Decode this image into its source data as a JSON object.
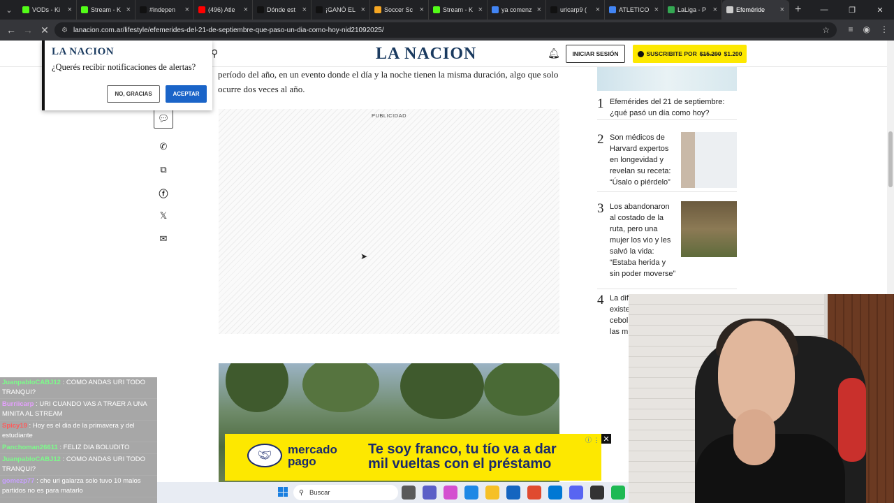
{
  "browser": {
    "tabs": [
      {
        "title": "VODs - Ki",
        "color": "#53fc18"
      },
      {
        "title": "Stream - K",
        "color": "#53fc18"
      },
      {
        "title": "#indepen",
        "color": "#111111"
      },
      {
        "title": "(496) Atle",
        "color": "#ff0000"
      },
      {
        "title": "Dónde est",
        "color": "#111111"
      },
      {
        "title": "¡GANÓ EL",
        "color": "#111111"
      },
      {
        "title": "Soccer Sc",
        "color": "#f5a623"
      },
      {
        "title": "Stream - K",
        "color": "#53fc18"
      },
      {
        "title": "ya comenz",
        "color": "#4285f4"
      },
      {
        "title": "uricarp9 (",
        "color": "#111111"
      },
      {
        "title": "ATLETICO",
        "color": "#4285f4"
      },
      {
        "title": "LaLiga - P",
        "color": "#34a853"
      },
      {
        "title": "Efeméride",
        "color": "#cccccc"
      }
    ],
    "url": "lanacion.com.ar/lifestyle/efemerides-del-21-de-septiembre-que-paso-un-dia-como-hoy-nid21092025/"
  },
  "header": {
    "logo": "LA NACION",
    "login_label": "INICIAR SESIÓN",
    "subscribe_prefix": "SUSCRIBITE POR",
    "subscribe_old_price": "$15.290",
    "subscribe_new_price": "$1.200"
  },
  "article": {
    "text": "período del año, en un evento donde el día y la noche tienen la misma duración, algo que solo ocurre dos veces al año.",
    "ad_label": "PUBLICIDAD"
  },
  "notification": {
    "logo": "LA NACION",
    "question": "¿Querés recibir notificaciones de alertas?",
    "decline_label": "NO, GRACIAS",
    "accept_label": "ACEPTAR"
  },
  "ranking": [
    {
      "num": "1",
      "title": "Efemérides del 21 de septiembre: ¿qué pasó un día como hoy?"
    },
    {
      "num": "2",
      "title": "Son médicos de Harvard expertos en longevidad y revelan su receta: “Úsalo o piérdelo”"
    },
    {
      "num": "3",
      "title": "Los abandonaron al costado de la ruta, pero una mujer los vio y les salvó la vida: “Estaba herida y sin poder moverse”"
    },
    {
      "num": "4",
      "title": "La dif existe cebol las m"
    }
  ],
  "ad_banner": {
    "brand_line1": "mercado",
    "brand_line2": "pago",
    "slogan_line1": "Te soy franco, tu tío va a dar",
    "slogan_line2": "mil vueltas con el préstamo"
  },
  "chat": [
    {
      "user": "JuanpabloCABJ12",
      "color": "#7cfc8a",
      "text": "COMO ANDAS URI TODO TRANQUI?"
    },
    {
      "user": "Burriicarp",
      "color": "#e6a0ff",
      "text": "URI CUANDO VAS A TRAER A UNA MINITA AL STREAM"
    },
    {
      "user": "Spicy19",
      "color": "#ff5a5a",
      "text": "Hoy es el dia de la primavera y del estudiante"
    },
    {
      "user": "Panchoman26611",
      "color": "#7cfc8a",
      "text": "FELIZ DIA BOLUDITO"
    },
    {
      "user": "JuanpabloCABJ12",
      "color": "#7cfc8a",
      "text": "COMO ANDAS URI TODO TRANQUI?"
    },
    {
      "user": "gomezp77",
      "color": "#c8a0ff",
      "text": "che uri galarza solo tuvo 10 malos partidos no es para matarlo"
    }
  ],
  "taskbar": {
    "search_placeholder": "Buscar",
    "icon_colors": [
      "#5a5a5a",
      "#5b5fc7",
      "#d44fd0",
      "#1e88e5",
      "#f6c026",
      "#1565c0",
      "#e04a2f",
      "#0078d4",
      "#5865f2",
      "#333333",
      "#1db954"
    ]
  }
}
